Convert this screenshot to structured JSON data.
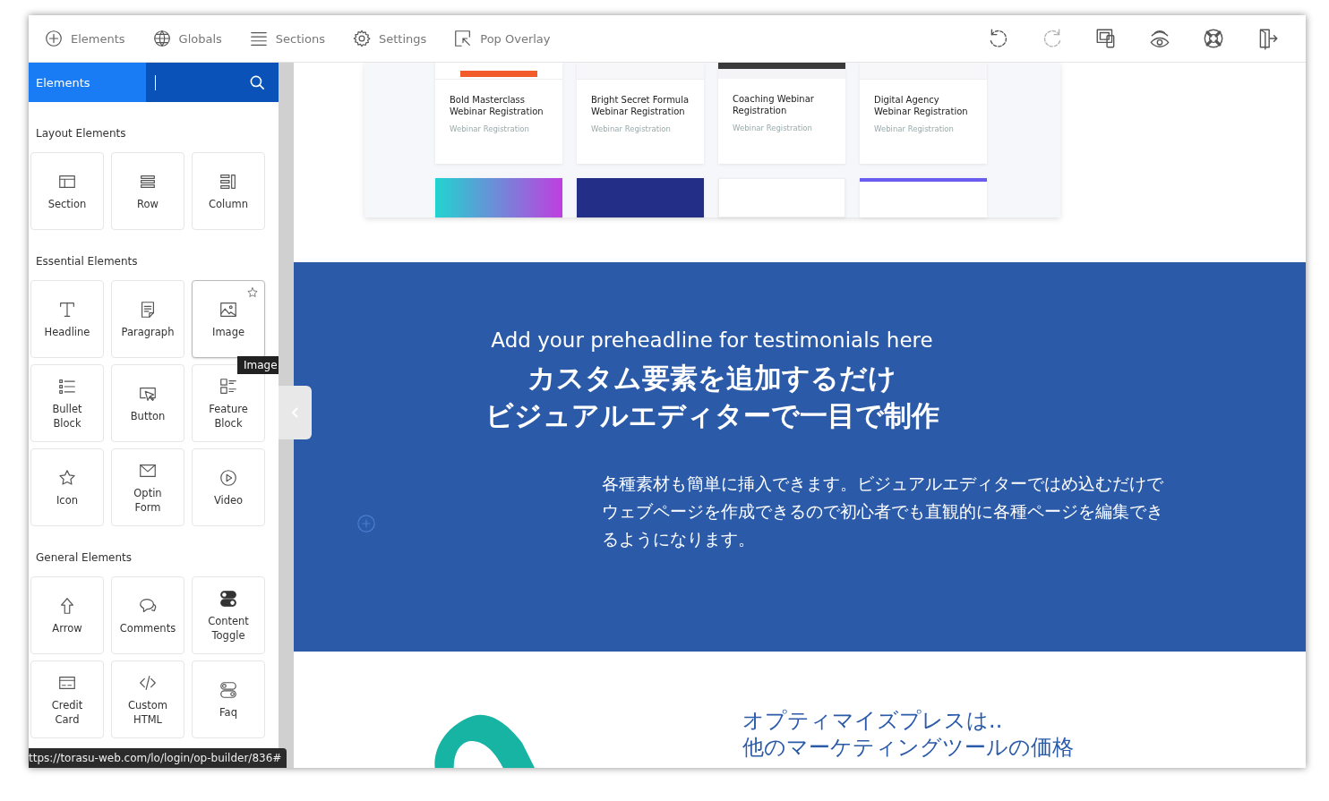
{
  "toolbar": {
    "items": [
      {
        "label": "Elements"
      },
      {
        "label": "Globals"
      },
      {
        "label": "Sections"
      },
      {
        "label": "Settings"
      },
      {
        "label": "Pop Overlay"
      }
    ],
    "actions": [
      {
        "disabled": false
      },
      {
        "disabled": true
      },
      {
        "disabled": false
      },
      {
        "disabled": false
      },
      {
        "disabled": false
      },
      {
        "disabled": false
      }
    ]
  },
  "sidebar": {
    "tab": "Elements",
    "search": {
      "focused": true
    },
    "groups": [
      {
        "title": "Layout Elements",
        "items": [
          {
            "label": "Section",
            "hovered": false
          },
          {
            "label": "Row",
            "hovered": false
          },
          {
            "label": "Column",
            "hovered": false
          }
        ]
      },
      {
        "title": "Essential Elements",
        "items": [
          {
            "label": "Headline",
            "hovered": false
          },
          {
            "label": "Paragraph",
            "hovered": false
          },
          {
            "label": "Image",
            "hovered": true,
            "tooltip": "Image"
          },
          {
            "label": "Bullet Block",
            "hovered": false
          },
          {
            "label": "Button",
            "hovered": false
          },
          {
            "label": "Feature Block",
            "hovered": false
          },
          {
            "label": "Icon",
            "hovered": false
          },
          {
            "label": "Optin Form",
            "hovered": false
          },
          {
            "label": "Video",
            "hovered": false
          }
        ]
      },
      {
        "title": "General Elements",
        "items": [
          {
            "label": "Arrow",
            "hovered": false
          },
          {
            "label": "Comments",
            "hovered": false
          },
          {
            "label": "Content Toggle",
            "hovered": false
          },
          {
            "label": "Credit Card",
            "hovered": false
          },
          {
            "label": "Custom HTML",
            "hovered": false
          },
          {
            "label": "Faq",
            "hovered": false
          }
        ]
      }
    ]
  },
  "status_url": "ttps://torasu-web.com/lo/login/op-builder/836#",
  "templates": {
    "cards": [
      {
        "title": "Bold Masterclass Webinar Registration",
        "category": "Webinar Registration"
      },
      {
        "title": "Bright Secret Formula Webinar Registration",
        "category": "Webinar Registration"
      },
      {
        "title": "Coaching Webinar Registration",
        "category": "Webinar Registration"
      },
      {
        "title": "Digital Agency Webinar Registration",
        "category": "Webinar Registration"
      }
    ]
  },
  "testimonials": {
    "preheadline": "Add your preheadline for testimonials here",
    "heading_lines": [
      "カスタム要素を追加するだけ",
      "ビジュアルエディターで一目で制作"
    ],
    "body": "各種素材も簡単に挿入できます。ビジュアルエディターではめ込むだけでウェブページを作成できるので初心者でも直観的に各種ページを編集できるようになります。"
  },
  "pricing": {
    "headline_lines": [
      "オプティマイズプレスは..",
      "他のマーケティングツールの価格"
    ]
  }
}
